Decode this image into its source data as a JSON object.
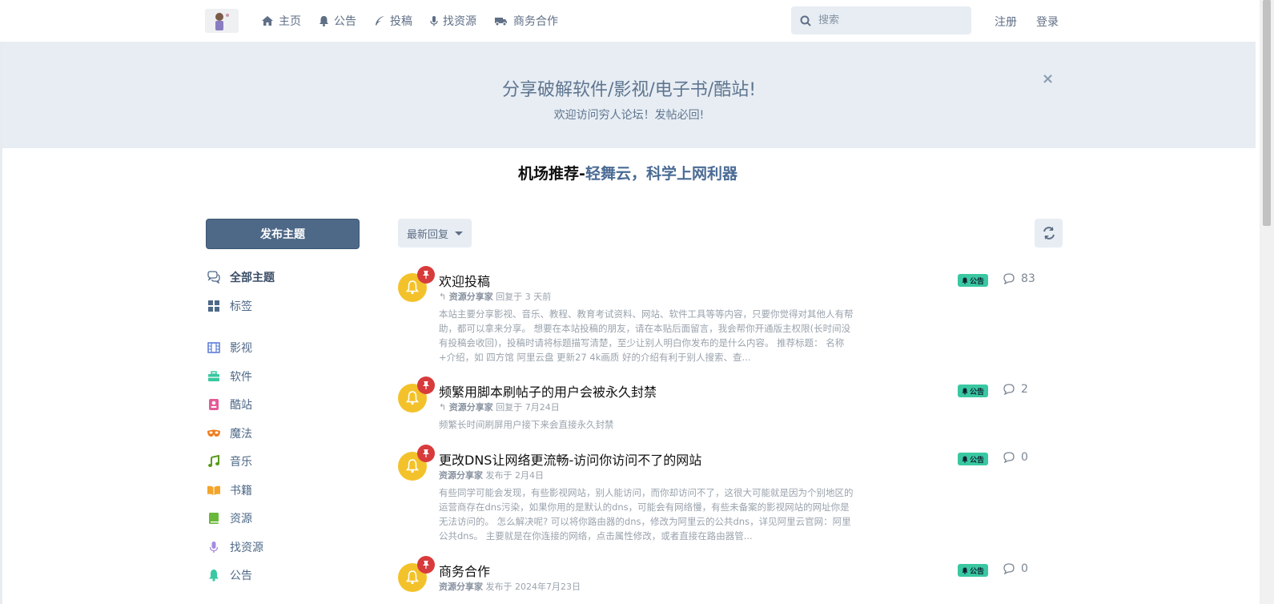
{
  "header": {
    "nav": [
      {
        "label": "主页",
        "icon": "home-icon"
      },
      {
        "label": "公告",
        "icon": "bell-icon"
      },
      {
        "label": "投稿",
        "icon": "feather-icon"
      },
      {
        "label": "找资源",
        "icon": "microphone-icon"
      },
      {
        "label": "商务合作",
        "icon": "truck-icon"
      }
    ],
    "search_placeholder": "搜索",
    "register": "注册",
    "login": "登录"
  },
  "banner": {
    "title": "分享破解软件/影视/电子书/酷站!",
    "subtitle": "欢迎访问穷人论坛！发帖必回!",
    "close": "×"
  },
  "promo": {
    "part1": "机场推荐-",
    "part2": "轻舞云，科学上网利器"
  },
  "sidebar": {
    "start_button": "发布主题",
    "items": [
      {
        "label": "全部主题",
        "icon": "comments-icon",
        "color": "#4e6887"
      },
      {
        "label": "标签",
        "icon": "grid-icon",
        "color": "#4e6887"
      },
      {
        "label": "影视",
        "icon": "film-icon",
        "color": "#5a7ad6"
      },
      {
        "label": "软件",
        "icon": "toolbox-icon",
        "color": "#39c8a1"
      },
      {
        "label": "酷站",
        "icon": "id-card-icon",
        "color": "#e35a96"
      },
      {
        "label": "魔法",
        "icon": "mask-icon",
        "color": "#f07c1e"
      },
      {
        "label": "音乐",
        "icon": "music-icon",
        "color": "#5a9a1c"
      },
      {
        "label": "书籍",
        "icon": "book-open-icon",
        "color": "#f3a52b"
      },
      {
        "label": "资源",
        "icon": "book-icon",
        "color": "#6ab83a"
      },
      {
        "label": "找资源",
        "icon": "microphone-icon",
        "color": "#a58be0"
      },
      {
        "label": "公告",
        "icon": "bell-icon",
        "color": "#39c8a1"
      }
    ]
  },
  "toolbar": {
    "sort_label": "最新回复"
  },
  "discussions": [
    {
      "title": "欢迎投稿",
      "meta_user": "资源分享家",
      "meta_text": "回复于 3 天前",
      "replied": true,
      "excerpt": "本站主要分享影视、音乐、教程、教育考试资料、网站、软件工具等等内容，只要你觉得对其他人有帮助，都可以拿来分享。 想要在本站投稿的朋友，请在本贴后面留言，我会帮你开通版主权限(长时间没有投稿会收回)，投稿时请将标题描写清楚，至少让别人明白你发布的是什么内容。 推荐标题： 名称+介绍，如 四方馆 阿里云盘 更新27 4k画质 好的介绍有利于别人搜索、查...",
      "tag": "公告",
      "count": "83"
    },
    {
      "title": "频繁用脚本刷帖子的用户会被永久封禁",
      "meta_user": "资源分享家",
      "meta_text": "回复于 7月24日",
      "replied": true,
      "excerpt": "频繁长时间刷屏用户接下来会直接永久封禁",
      "tag": "公告",
      "count": "2"
    },
    {
      "title": "更改DNS让网络更流畅-访问你访问不了的网站",
      "meta_user": "资源分享家",
      "meta_text": "发布于 2月4日",
      "replied": false,
      "excerpt": "有些同学可能会发现，有些影视网站，别人能访问，而你却访问不了，这很大可能就是因为个别地区的运营商存在dns污染，如果你用的是默认的dns，可能会有网络慢，有些未备案的影视网站的网址你是无法访问的。 怎么解决呢? 可以将你路由器的dns，修改为阿里云的公共dns，详见阿里云官网：阿里公共dns。 主要就是在你连接的网络，点击属性修改，或者直接在路由器管...",
      "tag": "公告",
      "count": "0"
    },
    {
      "title": "商务合作",
      "meta_user": "资源分享家",
      "meta_text": "发布于 2024年7月23日",
      "replied": false,
      "excerpt": "",
      "tag": "公告",
      "count": "0"
    }
  ]
}
